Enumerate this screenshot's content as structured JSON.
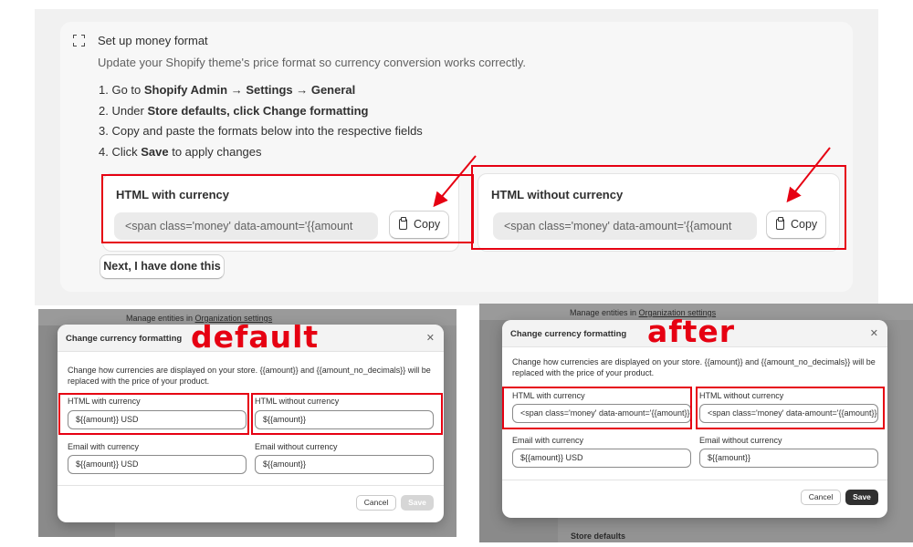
{
  "setup": {
    "title": "Set up money format",
    "description": "Update your Shopify theme's price format so currency conversion works correctly.",
    "steps": [
      [
        {
          "t": "1. Go to "
        },
        {
          "t": "Shopify Admin → Settings → General",
          "b": true
        }
      ],
      [
        {
          "t": "2. Under "
        },
        {
          "t": "Store defaults, click Change formatting",
          "b": true
        }
      ],
      [
        {
          "t": "3. Copy and paste the formats below into the respective fields"
        }
      ],
      [
        {
          "t": "4. Click "
        },
        {
          "t": "Save",
          "b": true
        },
        {
          "t": " to apply changes"
        }
      ]
    ],
    "html_with_currency": {
      "label": "HTML with currency",
      "value": "<span class='money' data-amount='{{amount",
      "copy_label": "Copy"
    },
    "html_without_currency": {
      "label": "HTML without currency",
      "value": "<span class='money' data-amount='{{amount",
      "copy_label": "Copy"
    },
    "next_label": "Next, I have done this"
  },
  "default_shot": {
    "annotation": "default",
    "background_text_prefix": "Manage entities in ",
    "background_link": "Organization settings",
    "modal": {
      "title": "Change currency formatting",
      "description": "Change how currencies are displayed on your store. {{amount}} and {{amount_no_decimals}} will be replaced with the price of your product.",
      "fields": [
        {
          "label": "HTML with currency",
          "value": "${{amount}} USD"
        },
        {
          "label": "HTML without currency",
          "value": "${{amount}}"
        },
        {
          "label": "Email with currency",
          "value": "${{amount}} USD"
        },
        {
          "label": "Email without currency",
          "value": "${{amount}}"
        }
      ],
      "cancel_label": "Cancel",
      "save_label": "Save"
    }
  },
  "after_shot": {
    "annotation": "after",
    "background_text_prefix": "Manage entities in ",
    "background_link": "Organization settings",
    "background_footer": "Store defaults",
    "modal": {
      "title": "Change currency formatting",
      "description": "Change how currencies are displayed on your store. {{amount}} and {{amount_no_decimals}} will be replaced with the price of your product.",
      "fields": [
        {
          "label": "HTML with currency",
          "value": "<span class='money' data-amount='{{amount}}'>"
        },
        {
          "label": "HTML without currency",
          "value": "<span class='money' data-amount='{{amount}}'>"
        },
        {
          "label": "Email with currency",
          "value": "${{amount}} USD"
        },
        {
          "label": "Email without currency",
          "value": "${{amount}}"
        }
      ],
      "cancel_label": "Cancel",
      "save_label": "Save"
    }
  },
  "colors": {
    "annotation_red": "#e60012",
    "save_disabled": "#d6d6d6",
    "save_enabled": "#303030"
  }
}
